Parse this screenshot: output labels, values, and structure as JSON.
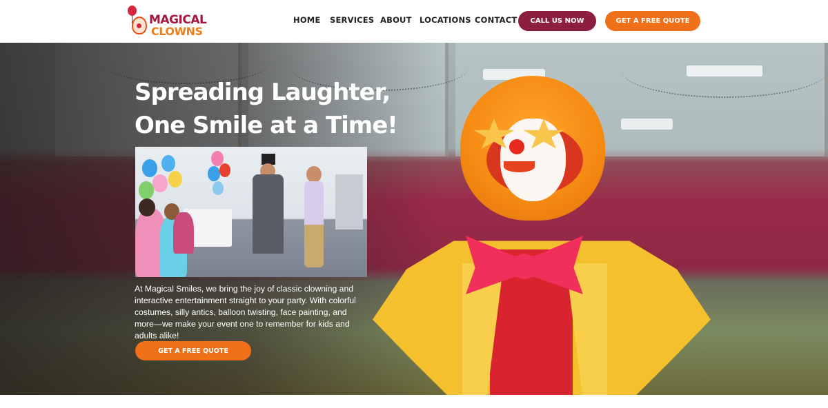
{
  "brand": {
    "name_line1": "MAGICAL",
    "name_line2": "CLOWNS",
    "colors": {
      "primary": "#8c1f3f",
      "accent": "#f07019",
      "logo_red": "#a3163f",
      "logo_orange": "#f07d1a"
    }
  },
  "nav": {
    "items": [
      {
        "label": "HOME"
      },
      {
        "label": "SERVICES"
      },
      {
        "label": "ABOUT"
      },
      {
        "label": "LOCATIONS"
      },
      {
        "label": "CONTACT"
      }
    ],
    "call_button": "CALL US NOW",
    "quote_button": "GET A FREE QUOTE"
  },
  "hero": {
    "title_line1": "Spreading Laughter,",
    "title_line2": "One Smile at a Time!",
    "description": "At Magical Smiles, we bring the joy of classic clowning and interactive entertainment straight to your party. With colorful costumes, silly antics, balloon twisting, face painting, and more—we make your event one to remember for kids and adults alike!",
    "cta_button": "GET A FREE QUOTE"
  },
  "icons": {
    "logo": "clown-logo-icon"
  }
}
